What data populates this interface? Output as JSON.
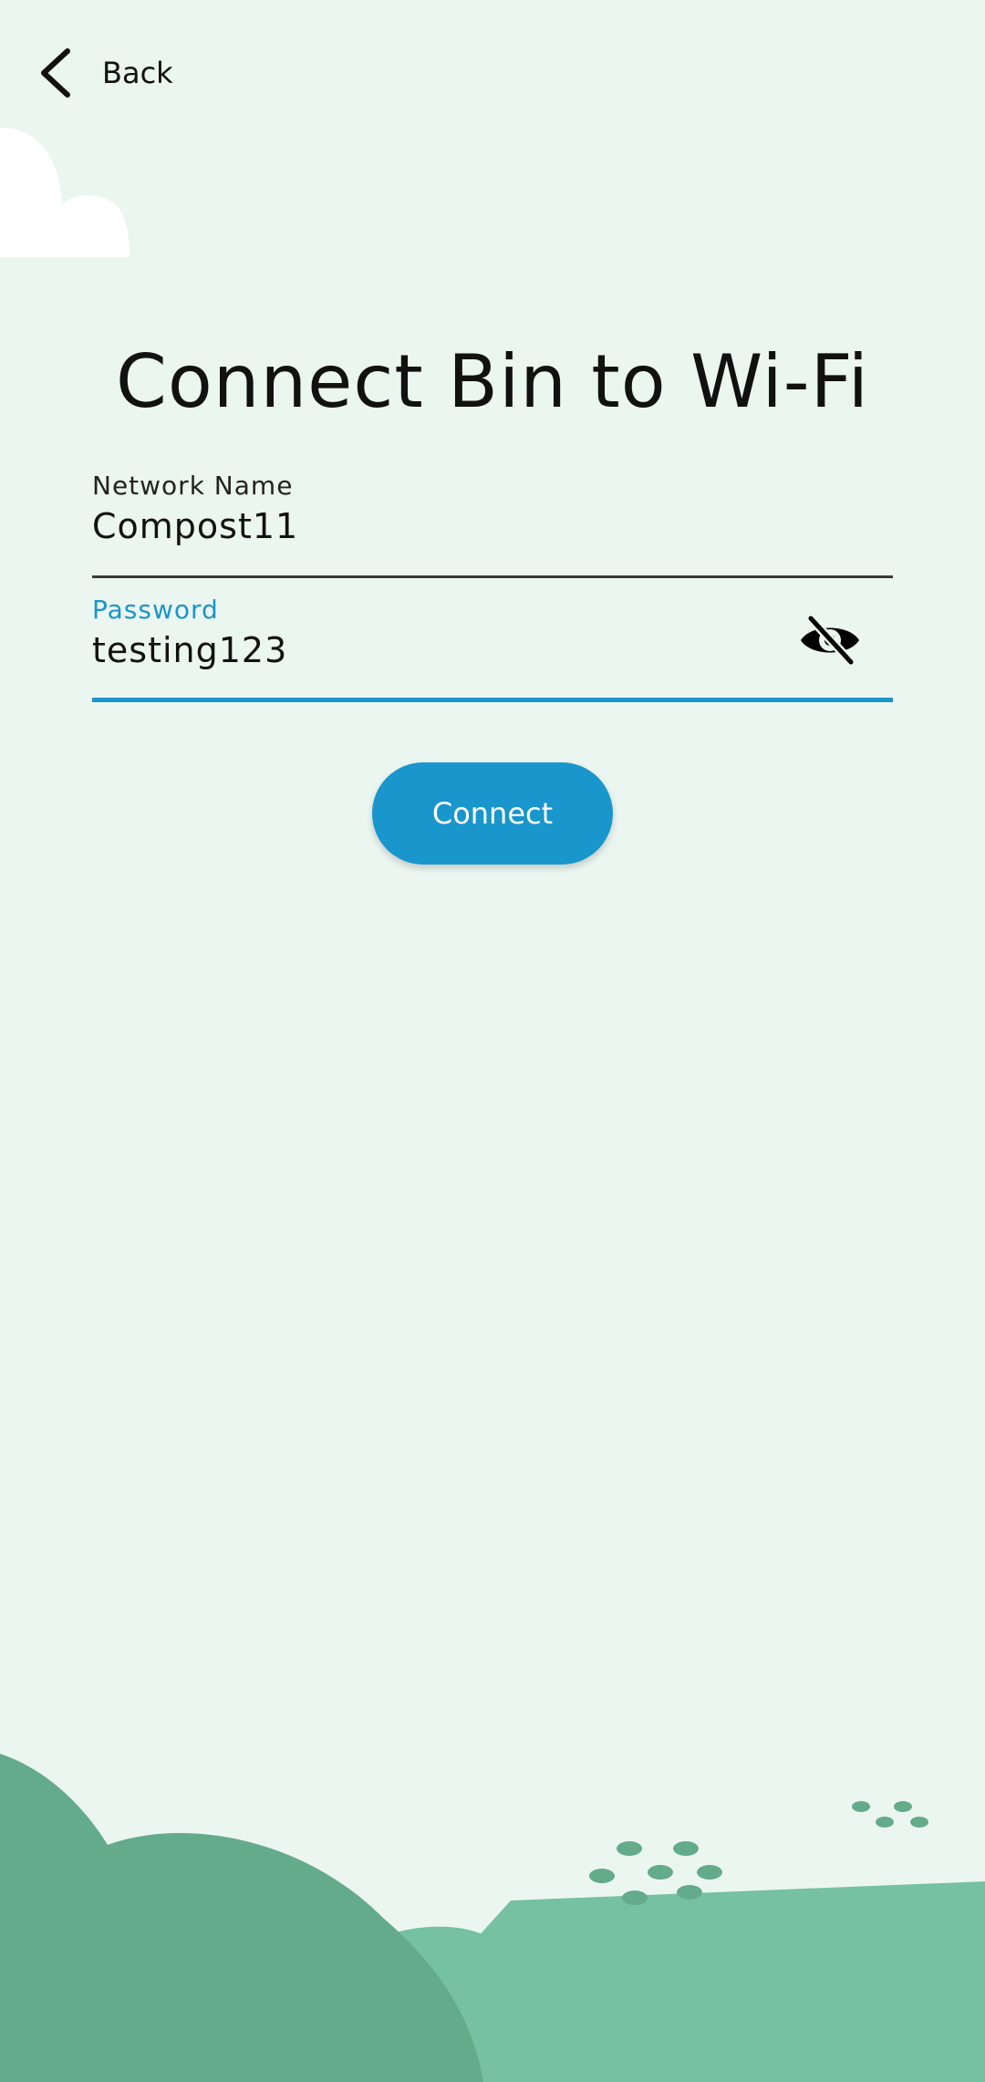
{
  "header": {
    "back_label": "Back",
    "back_icon": "chevron-left-icon"
  },
  "title": "Connect Bin to Wi-Fi",
  "network": {
    "label": "Network Name",
    "value": "Compost11"
  },
  "password": {
    "label": "Password",
    "value": "testing123",
    "toggle_icon": "eye-off-icon"
  },
  "connect_label": "Connect",
  "colors": {
    "background": "#ecf6f1",
    "accent": "#1996cc",
    "hill_dark": "#63ab8b",
    "hill_light": "#75c1a1"
  }
}
